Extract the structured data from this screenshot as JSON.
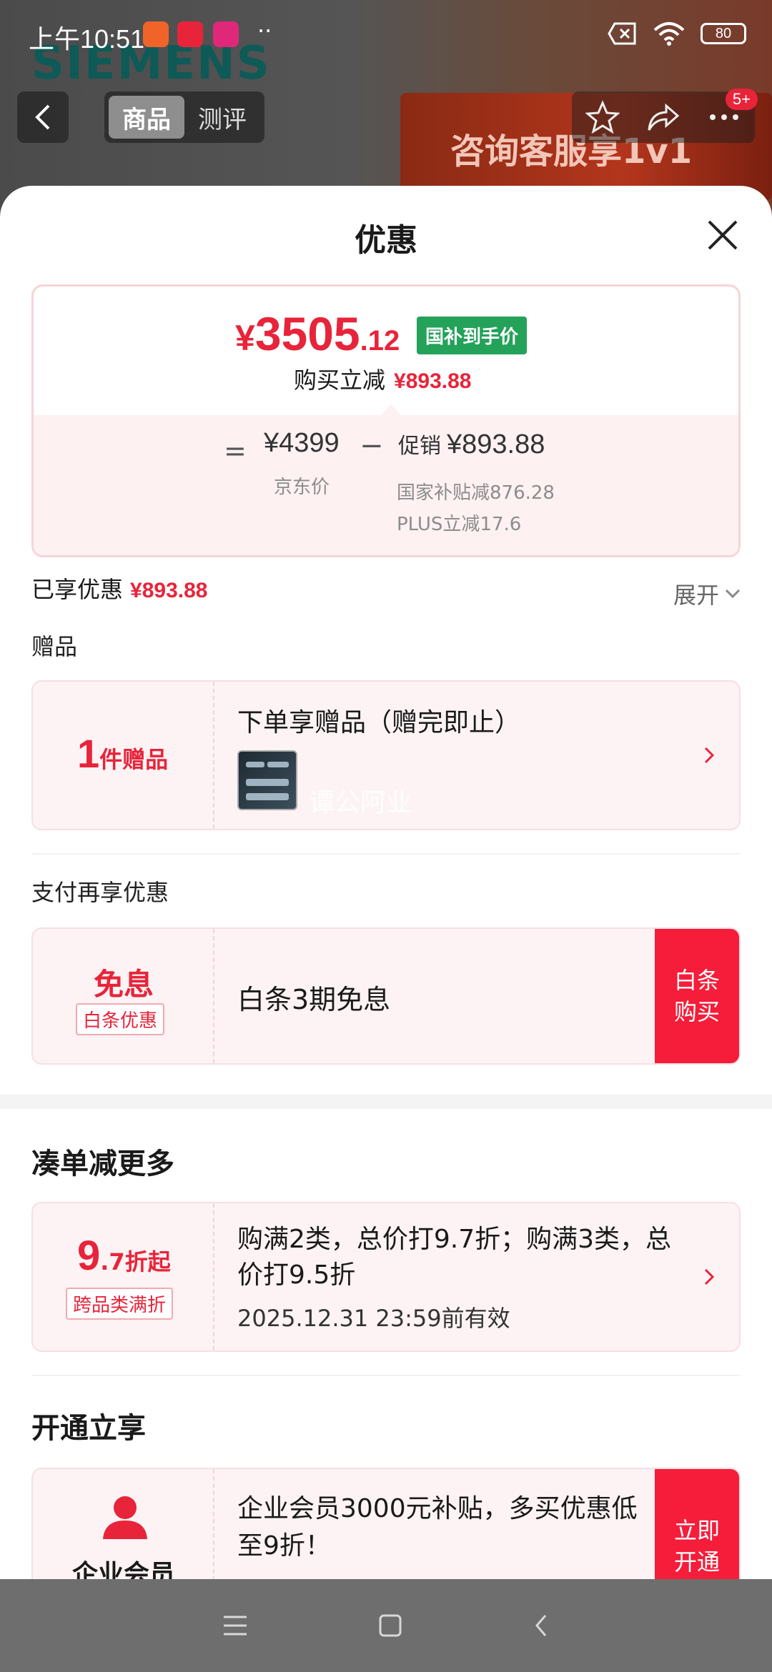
{
  "status_bar": {
    "time": "上午10:51",
    "dots": "··",
    "battery": "80"
  },
  "background_page": {
    "brand": "SIEMENS",
    "banner_text": "咨询客服享1v1"
  },
  "top_nav": {
    "tabs": [
      {
        "label": "商品",
        "active": true
      },
      {
        "label": "测评",
        "active": false
      }
    ],
    "badge": "5+"
  },
  "sheet": {
    "title": "优惠"
  },
  "price_card": {
    "currency": "¥",
    "price_int": "3505",
    "price_dec": ".12",
    "tag": "国补到手价",
    "reduce_label": "购买立减",
    "reduce_value": "¥893.88",
    "eq": "=",
    "jd_price": "¥4399",
    "jd_label": "京东价",
    "minus": "−",
    "promo_label": "促销",
    "promo_value": "¥893.88",
    "promo_detail_1": "国家补贴减876.28",
    "promo_detail_2": "PLUS立减17.6"
  },
  "enjoyed": {
    "label": "已享优惠",
    "value": "¥893.88",
    "expand_label": "展开"
  },
  "gift": {
    "section_label": "赠品",
    "count": "1",
    "count_unit": "件赠品",
    "title": "下单享赠品（赠完即止）",
    "watermark": "谭公阿业"
  },
  "payment": {
    "section_label": "支付再享优惠",
    "left_title": "免息",
    "left_tag": "白条优惠",
    "body_text": "白条3期免息",
    "button": "白条\n购买"
  },
  "discount": {
    "section_label": "凑单减更多",
    "num": "9",
    "num_suffix": ".7折起",
    "tag": "跨品类满折",
    "text": "购满2类，总价打9.7折；购满3类，总价打9.5折",
    "valid": "2025.12.31 23:59前有效"
  },
  "membership": {
    "section_label": "开通立享",
    "name": "企业会员",
    "text": "企业会员3000元补贴，多买优惠低至9折！",
    "button": "立即\n开通"
  },
  "colors": {
    "accent": "#e8243a",
    "tag_green": "#24a25a",
    "card_bg": "#fdf3f4"
  }
}
